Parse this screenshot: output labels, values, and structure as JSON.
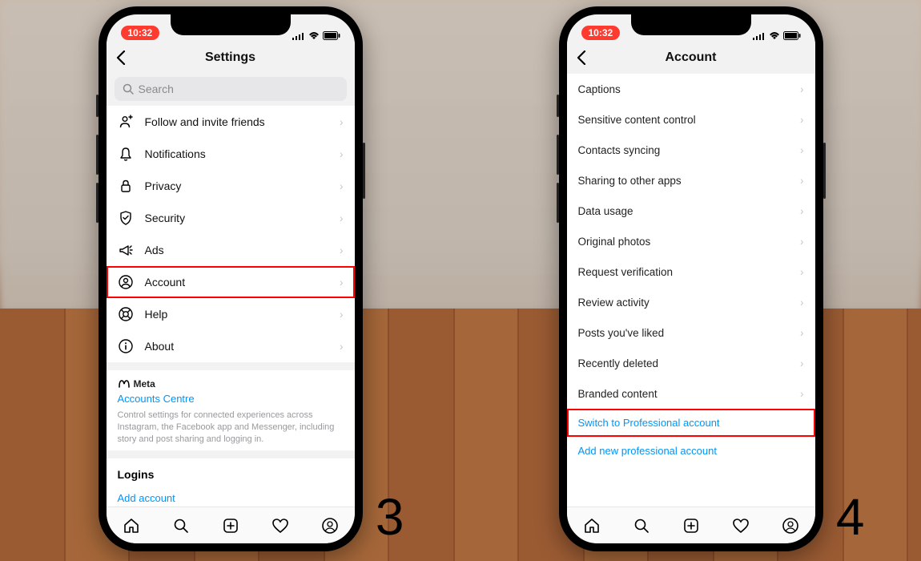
{
  "status": {
    "time": "10:32"
  },
  "colors": {
    "accent": "#0095f6",
    "highlight": "#ff0000"
  },
  "screen3": {
    "step": "3",
    "title": "Settings",
    "search_placeholder": "Search",
    "items": [
      {
        "icon": "person-plus-icon",
        "label": "Follow and invite friends",
        "highlight": false
      },
      {
        "icon": "bell-icon",
        "label": "Notifications",
        "highlight": false
      },
      {
        "icon": "lock-icon",
        "label": "Privacy",
        "highlight": false
      },
      {
        "icon": "shield-icon",
        "label": "Security",
        "highlight": false
      },
      {
        "icon": "megaphone-icon",
        "label": "Ads",
        "highlight": false
      },
      {
        "icon": "person-circle-icon",
        "label": "Account",
        "highlight": true
      },
      {
        "icon": "life-ring-icon",
        "label": "Help",
        "highlight": false
      },
      {
        "icon": "info-icon",
        "label": "About",
        "highlight": false
      }
    ],
    "meta": {
      "brand": "Meta",
      "link": "Accounts Centre",
      "desc": "Control settings for connected experiences across Instagram, the Facebook app and Messenger, including story and post sharing and logging in."
    },
    "logins_header": "Logins",
    "add_account": "Add account"
  },
  "screen4": {
    "step": "4",
    "title": "Account",
    "items": [
      "Captions",
      "Sensitive content control",
      "Contacts syncing",
      "Sharing to other apps",
      "Data usage",
      "Original photos",
      "Request verification",
      "Review activity",
      "Posts you've liked",
      "Recently deleted",
      "Branded content"
    ],
    "switch_link": "Switch to Professional account",
    "add_new_link": "Add new professional account"
  },
  "tabs": [
    "home",
    "search",
    "create",
    "activity",
    "profile"
  ]
}
